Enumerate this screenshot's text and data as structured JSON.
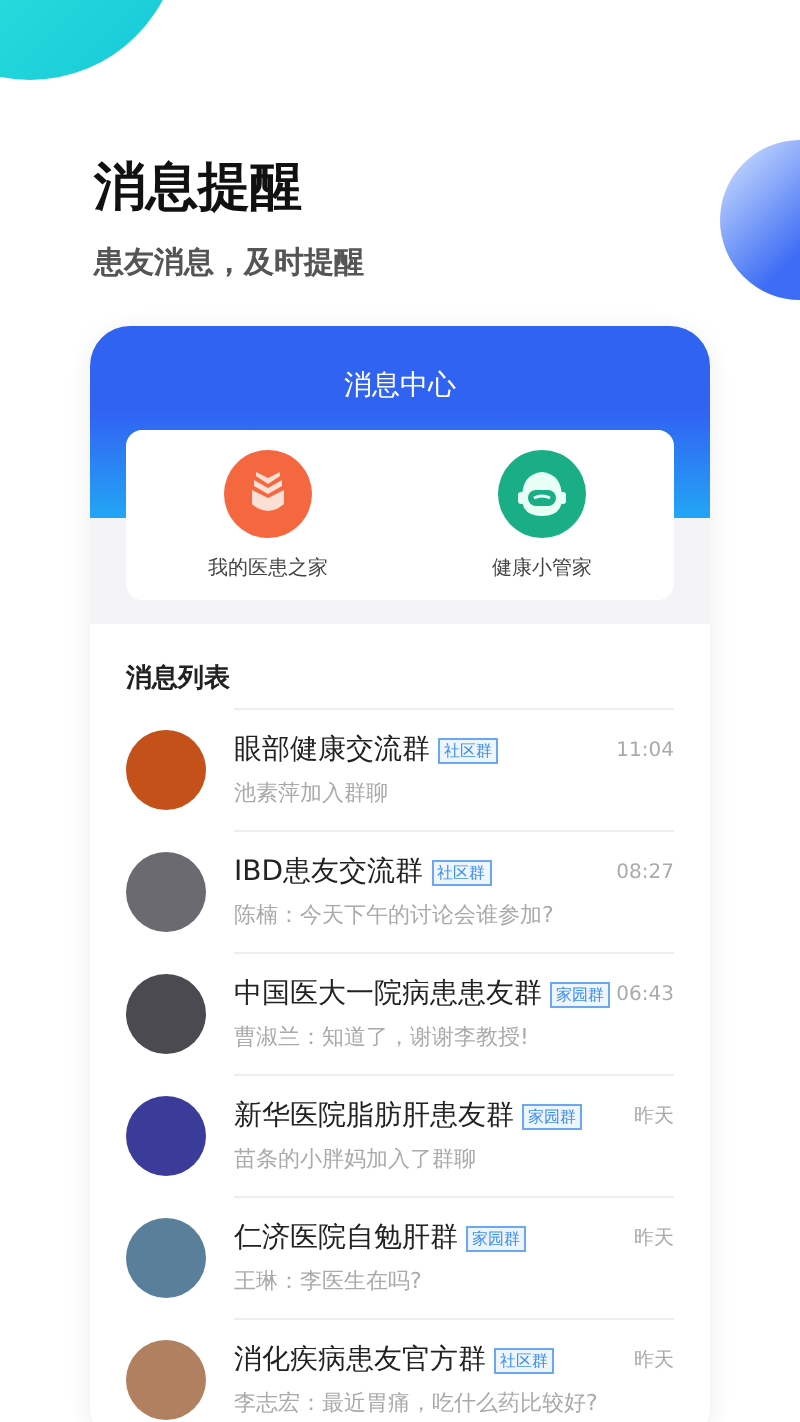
{
  "headline": "消息提醒",
  "subtitle": "患友消息，及时提醒",
  "phone": {
    "title": "消息中心",
    "shortcuts": [
      {
        "kind": "home",
        "label": "我的医患之家"
      },
      {
        "kind": "robot",
        "label": "健康小管家"
      }
    ],
    "list_title": "消息列表",
    "messages": [
      {
        "name": "眼部健康交流群",
        "tag": "社区群",
        "time": "11:04",
        "preview": "池素萍加入群聊"
      },
      {
        "name": "IBD患友交流群",
        "tag": "社区群",
        "time": "08:27",
        "preview": "陈楠：今天下午的讨论会谁参加?"
      },
      {
        "name": "中国医大一院病患患友群",
        "tag": "家园群",
        "time": "06:43",
        "preview": "曹淑兰：知道了，谢谢李教授!"
      },
      {
        "name": "新华医院脂肪肝患友群",
        "tag": "家园群",
        "time": "昨天",
        "preview": "苗条的小胖妈加入了群聊"
      },
      {
        "name": "仁济医院自勉肝群",
        "tag": "家园群",
        "time": "昨天",
        "preview": "王琳：李医生在吗?"
      },
      {
        "name": "消化疾病患友官方群",
        "tag": "社区群",
        "time": "昨天",
        "preview": "李志宏：最近胃痛，吃什么药比较好?"
      }
    ]
  }
}
